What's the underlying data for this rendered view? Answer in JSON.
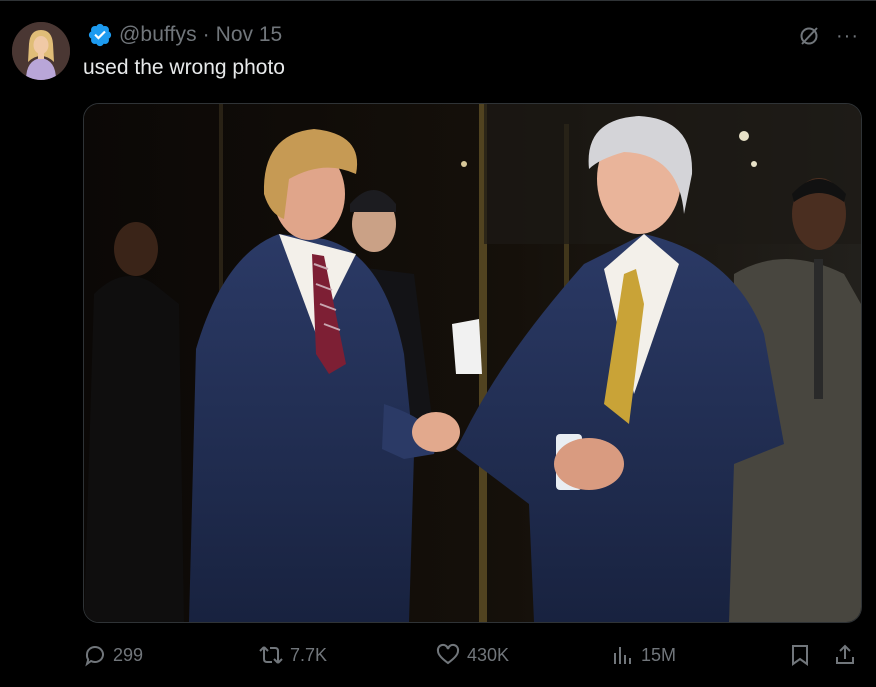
{
  "tweet": {
    "handle": "@buffys",
    "separator": "·",
    "date": "Nov 15",
    "text": "used the wrong photo",
    "more_label": "···"
  },
  "media": {
    "type": "photo"
  },
  "actions": {
    "replies": "299",
    "reposts": "7.7K",
    "likes": "430K",
    "views": "15M"
  },
  "icons": {
    "verified": "verified-badge-icon",
    "grok": "grok-icon",
    "more": "more-icon",
    "reply": "reply-icon",
    "repost": "repost-icon",
    "like": "heart-icon",
    "views": "views-icon",
    "bookmark": "bookmark-icon",
    "share": "share-icon"
  },
  "colors": {
    "background": "#000000",
    "text": "#e7e9ea",
    "muted": "#71767b",
    "verified": "#1d9bf0"
  }
}
